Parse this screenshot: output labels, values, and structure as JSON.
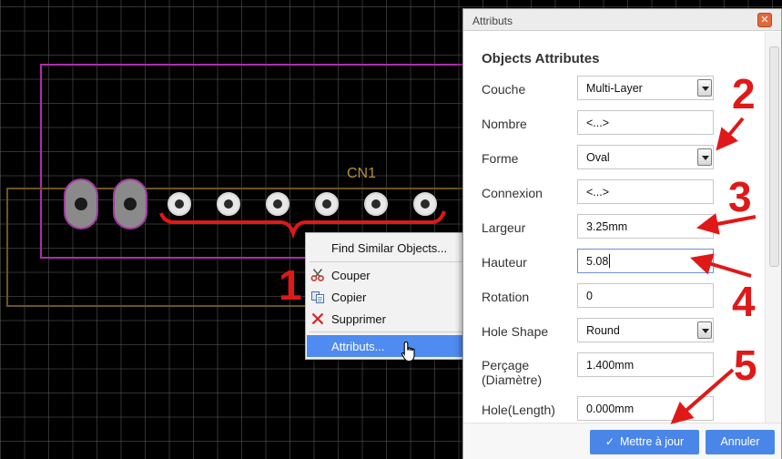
{
  "pcb": {
    "designator": "CN1"
  },
  "context_menu": {
    "items": [
      {
        "label": "Find Similar Objects...",
        "icon": ""
      },
      {
        "label": "Couper",
        "icon": "scissors-icon"
      },
      {
        "label": "Copier",
        "icon": "copy-icon"
      },
      {
        "label": "Supprimer",
        "icon": "delete-x-icon"
      },
      {
        "label": "Attributs...",
        "icon": "",
        "highlighted": true
      }
    ],
    "highlight_color": "#4f8bf0"
  },
  "dialog": {
    "title": "Attributs",
    "heading": "Objects Attributes",
    "fields": [
      {
        "label": "Couche",
        "value": "Multi-Layer",
        "type": "select"
      },
      {
        "label": "Nombre",
        "value": "<...>",
        "type": "text"
      },
      {
        "label": "Forme",
        "value": "Oval",
        "type": "select"
      },
      {
        "label": "Connexion",
        "value": "<...>",
        "type": "text"
      },
      {
        "label": "Largeur",
        "value": "3.25mm",
        "type": "text"
      },
      {
        "label": "Hauteur",
        "value": "5.08",
        "type": "text",
        "focused": true
      },
      {
        "label": "Rotation",
        "value": "0",
        "type": "text"
      },
      {
        "label": "Hole Shape",
        "value": "Round",
        "type": "select"
      },
      {
        "label_line1": "Perçage",
        "label_line2": "(Diamètre)",
        "value": "1.400mm",
        "type": "text"
      },
      {
        "label": "Hole(Length)",
        "value": "0.000mm",
        "type": "text"
      }
    ],
    "buttons": {
      "update": "Mettre à jour",
      "cancel": "Annuler"
    },
    "accent_color": "#4a86e8"
  },
  "annotations": {
    "numbers": [
      "1",
      "2",
      "3",
      "4",
      "5"
    ],
    "color": "#e01818"
  }
}
